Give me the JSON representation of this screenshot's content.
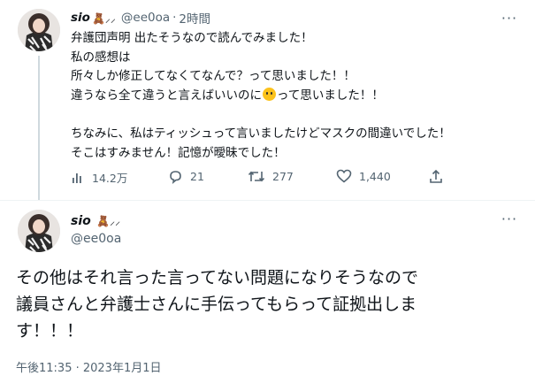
{
  "tweet": {
    "user_name": "sio",
    "name_emoji": "🧸⸝⸝",
    "handle": "@ee0oa",
    "separator": "·",
    "time_ago": "2時間",
    "body_lines": [
      "弁護団声明 出たそうなので読んでみました！",
      "私の感想は",
      "所々しか修正してなくてなんで？って思いました！！",
      "違うなら全て違うと言えばいいのに",
      "ちなみに、私はティッシュって言いましたけどマスクの間違いでした！",
      "そこはすみません！記憶が曖昧でした！"
    ],
    "body_line4_after_emoji": "って思いました！！",
    "emoji_icon": "smiling-face-emoji",
    "stats": {
      "views": "14.2万",
      "replies": "21",
      "retweets": "277",
      "likes": "1,440"
    }
  },
  "reply": {
    "user_name": "sio",
    "name_emoji": "🧸⸝⸝",
    "handle": "@ee0oa",
    "body_lines": [
      "その他はそれ言った言ってない問題になりそうなので",
      "議員さんと弁護士さんに手伝ってもらって証拠出しま",
      "す！！！"
    ],
    "timestamp": "午後11:35 · 2023年1月1日"
  },
  "colors": {
    "text": "#0f1419",
    "secondary": "#536471",
    "thread_line": "#cfd9de",
    "divider": "#eff3f4"
  },
  "icons": [
    "views-icon",
    "reply-icon",
    "retweet-icon",
    "like-icon",
    "share-icon",
    "more-icon"
  ]
}
